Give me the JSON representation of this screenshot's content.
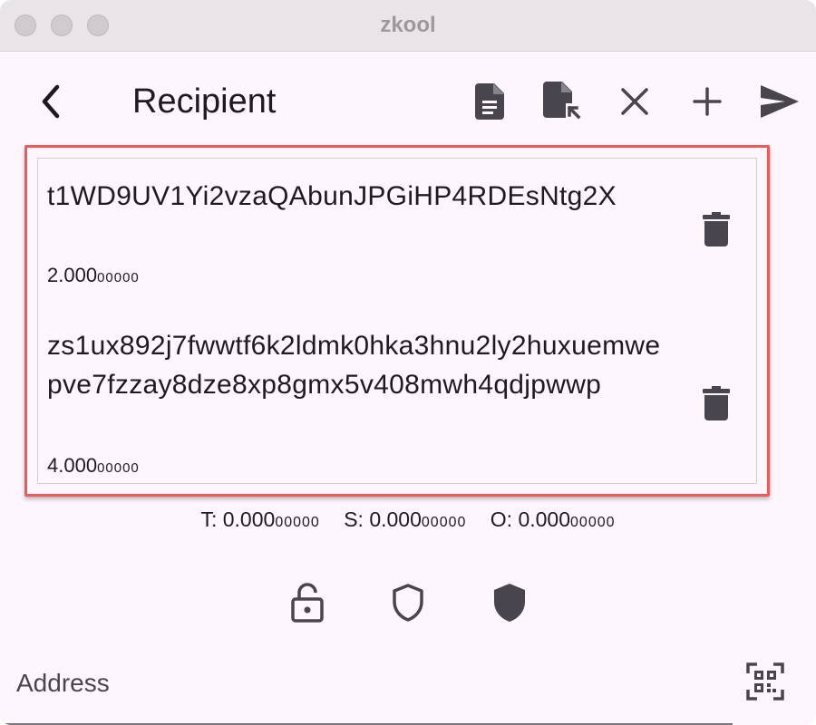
{
  "window": {
    "title": "zkool"
  },
  "appbar": {
    "title": "Recipient",
    "icons": [
      "back-icon",
      "document-icon",
      "document-import-icon",
      "close-icon",
      "add-icon",
      "send-icon"
    ]
  },
  "recipients": [
    {
      "address": "t1WD9UV1Yi2vzaQAbunJPGiHP4RDEsNtg2X",
      "amount_main": "2.000",
      "amount_small": "00000"
    },
    {
      "address": "zs1ux892j7fwwtf6k2ldmk0hka3hnu2ly2huxuemwepve7fzzay8dze8xp8gmx5v408mwh4qdjpwwp",
      "amount_main": "4.000",
      "amount_small": "00000"
    }
  ],
  "totals": {
    "t_label": "T:",
    "t_main": "0.000",
    "t_small": "00000",
    "s_label": "S:",
    "s_main": "0.000",
    "s_small": "00000",
    "o_label": "O:",
    "o_main": "0.000",
    "o_small": "00000"
  },
  "pools": {
    "icons": [
      "unlock-icon",
      "shield-outline-icon",
      "shield-filled-icon"
    ]
  },
  "address_field": {
    "placeholder": "Address",
    "value": ""
  },
  "colors": {
    "background": "#fdf6fd",
    "highlight": "#ee5a55",
    "icon": "#49454f",
    "text": "#1d1b20"
  }
}
